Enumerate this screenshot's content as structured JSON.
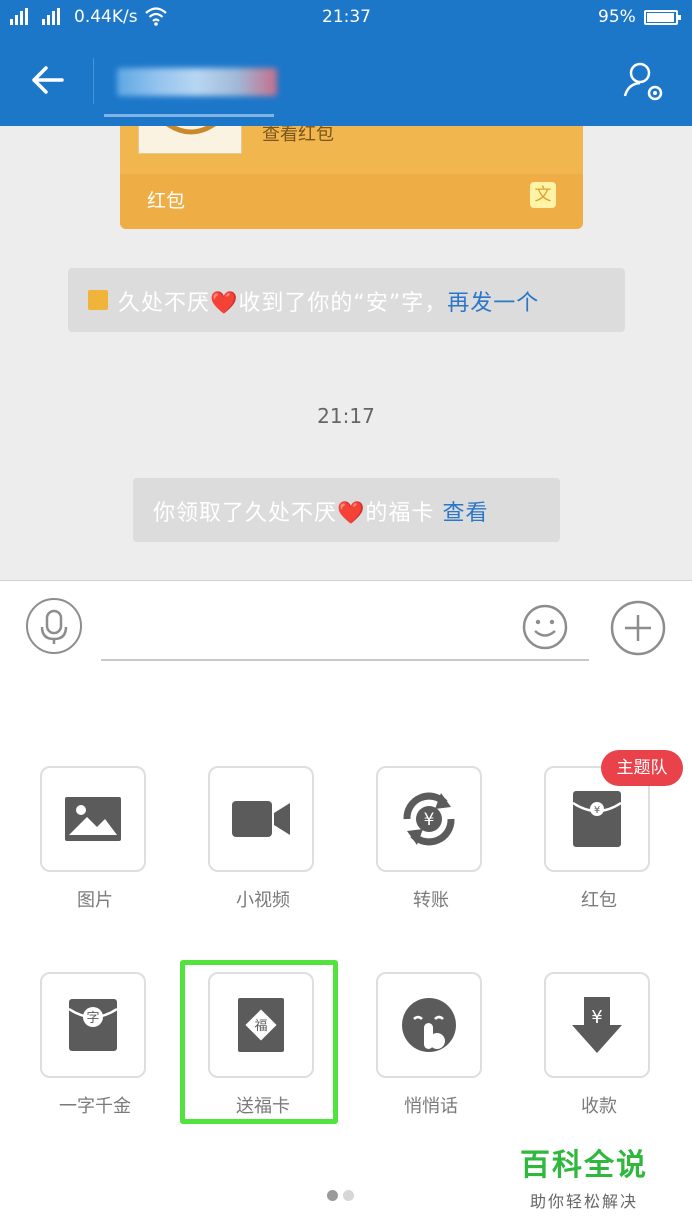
{
  "status_bar": {
    "signal_text": "4G 3G",
    "network_speed": "0.44K/s",
    "time": "21:37",
    "battery": "95%",
    "battery_level": 0.95
  },
  "title_bar": {
    "accent": "#1d77c9",
    "back_icon": "arrow-left-icon",
    "profile_icon": "profile-settings-icon"
  },
  "chat": {
    "red_packet": {
      "upper_text": "查看红包",
      "footer_label": "红包",
      "logo_glyph": "文"
    },
    "system_message_1": {
      "prefix": "久处不厌",
      "heart": "❤️",
      "suffix": "收到了你的“安”字，",
      "action": "再发一个"
    },
    "timestamp": "21:17",
    "system_message_2": {
      "prefix": "你领取了久处不厌",
      "heart": "❤️",
      "suffix": "的福卡",
      "action": "查看"
    }
  },
  "input": {
    "placeholder": "",
    "value": ""
  },
  "panel": {
    "items": [
      {
        "label": "图片",
        "icon": "image-icon"
      },
      {
        "label": "小视频",
        "icon": "video-camera-icon"
      },
      {
        "label": "转账",
        "icon": "transfer-yuan-icon"
      },
      {
        "label": "红包",
        "icon": "red-packet-icon"
      },
      {
        "label": "一字千金",
        "icon": "character-packet-icon",
        "glyph": "字"
      },
      {
        "label": "送福卡",
        "icon": "fu-card-icon",
        "glyph": "福"
      },
      {
        "label": "悄悄话",
        "icon": "whisper-icon"
      },
      {
        "label": "收款",
        "icon": "receive-payment-icon"
      }
    ],
    "badge": "主题队",
    "highlight_color": "#53e33f",
    "page_count": 2,
    "active_page": 1
  },
  "watermark": {
    "title": "百科全说",
    "subtitle": "助你轻松解决"
  }
}
